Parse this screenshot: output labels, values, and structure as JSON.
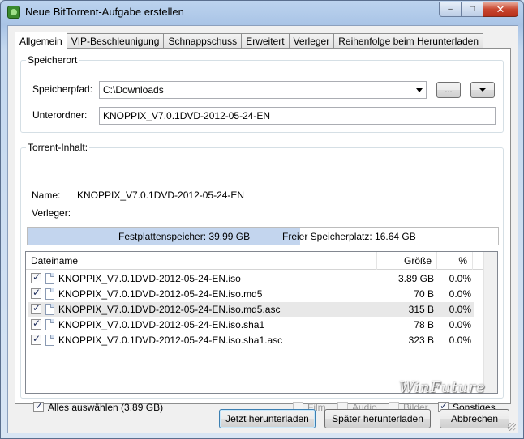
{
  "window": {
    "title": "Neue BitTorrent-Aufgabe erstellen",
    "controls": {
      "minimize": "–",
      "maximize": "□",
      "close": "✕"
    }
  },
  "tabs": [
    {
      "label": "Allgemein",
      "active": true
    },
    {
      "label": "VIP-Beschleunigung",
      "active": false
    },
    {
      "label": "Schnappschuss",
      "active": false
    },
    {
      "label": "Erweitert",
      "active": false
    },
    {
      "label": "Verleger",
      "active": false
    },
    {
      "label": "Reihenfolge beim Herunterladen",
      "active": false
    }
  ],
  "speicherort": {
    "legend": "Speicherort",
    "path_label": "Speicherpfad:",
    "path_value": "C:\\Downloads",
    "browse_label": "...",
    "subfolder_label": "Unterordner:",
    "subfolder_value": "KNOPPIX_V7.0.1DVD-2012-05-24-EN"
  },
  "content": {
    "legend": "Torrent-Inhalt:",
    "name_label": "Name:",
    "name_value": "KNOPPIX_V7.0.1DVD-2012-05-24-EN",
    "publisher_label": "Verleger:",
    "publisher_value": "",
    "disk_space": "Festplattenspeicher: 39.99 GB",
    "free_space": "Freier Speicherplatz: 16.64 GB",
    "disk_fill_fraction": 0.58
  },
  "filelist": {
    "columns": {
      "name": "Dateiname",
      "size": "Größe",
      "percent": "%"
    },
    "rows": [
      {
        "name": "KNOPPIX_V7.0.1DVD-2012-05-24-EN.iso",
        "size": "3.89 GB",
        "percent": "0.0%",
        "checked": true
      },
      {
        "name": "KNOPPIX_V7.0.1DVD-2012-05-24-EN.iso.md5",
        "size": "70 B",
        "percent": "0.0%",
        "checked": true
      },
      {
        "name": "KNOPPIX_V7.0.1DVD-2012-05-24-EN.iso.md5.asc",
        "size": "315 B",
        "percent": "0.0%",
        "checked": true
      },
      {
        "name": "KNOPPIX_V7.0.1DVD-2012-05-24-EN.iso.sha1",
        "size": "78 B",
        "percent": "0.0%",
        "checked": true
      },
      {
        "name": "KNOPPIX_V7.0.1DVD-2012-05-24-EN.iso.sha1.asc",
        "size": "323 B",
        "percent": "0.0%",
        "checked": true
      }
    ]
  },
  "filters": {
    "select_all": "Alles auswählen (3.89 GB)",
    "film": "Film",
    "audio": "Audio",
    "bilder": "Bilder",
    "sonstiges": "Sonstiges"
  },
  "buttons": {
    "download_now": "Jetzt herunterladen",
    "download_later": "Später herunterladen",
    "cancel": "Abbrechen"
  },
  "watermark": "WinFuture"
}
